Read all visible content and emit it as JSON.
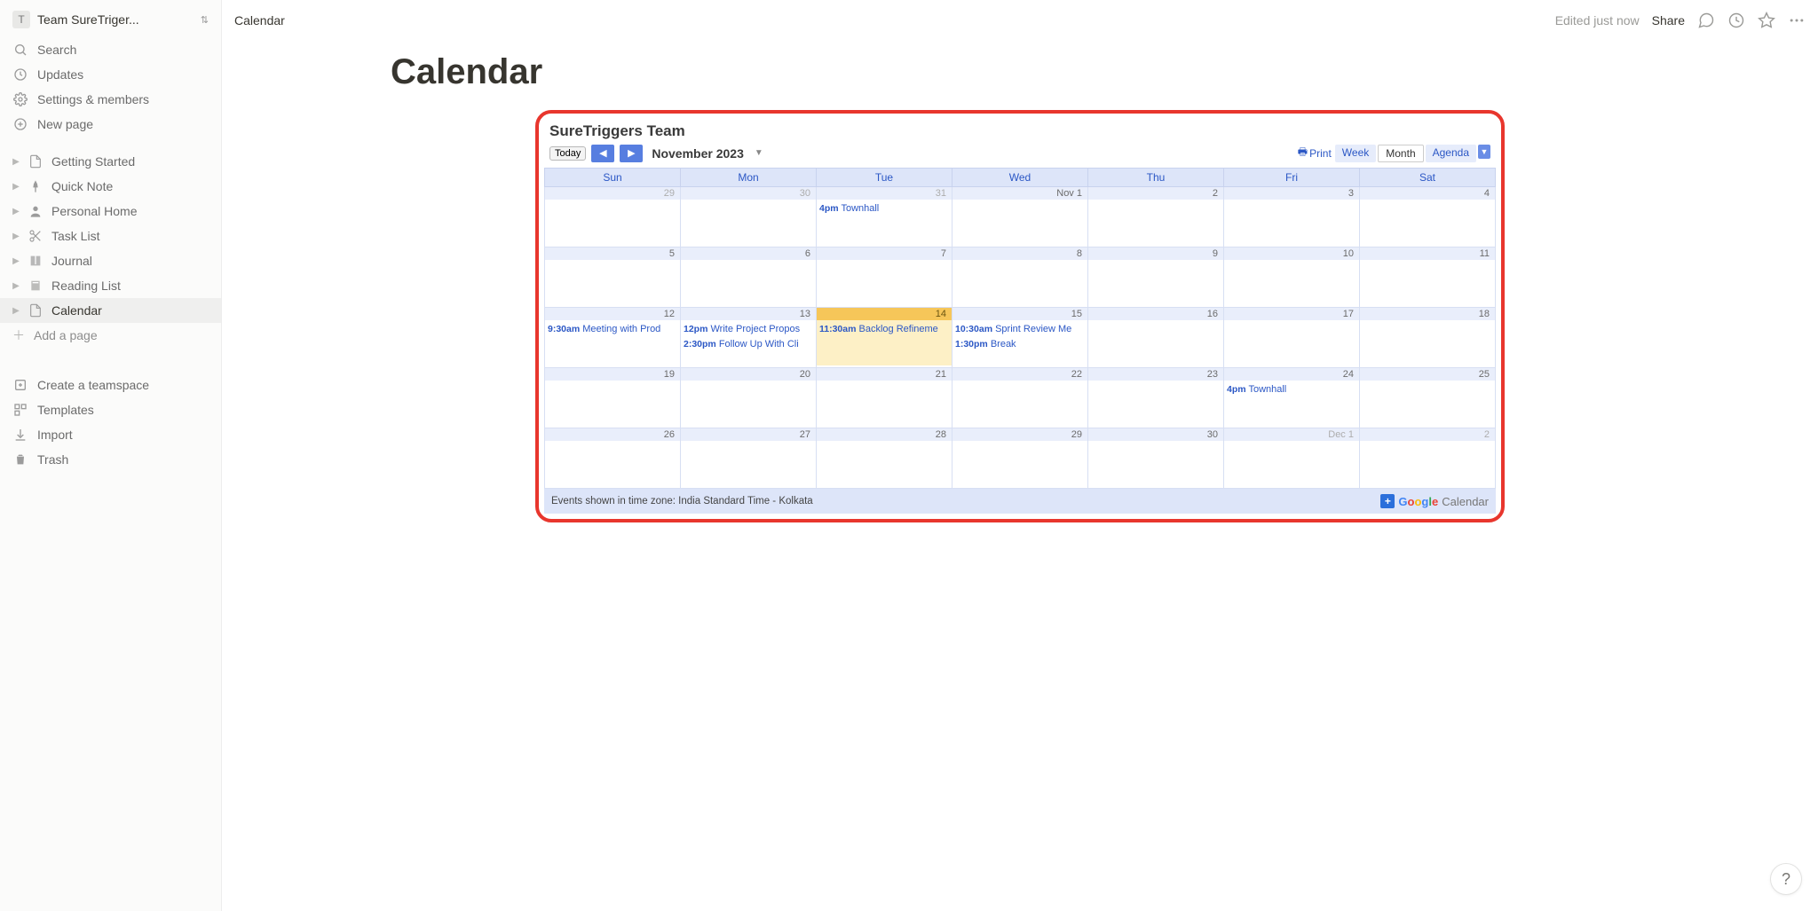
{
  "workspace": {
    "badge": "T",
    "name": "Team SureTriger..."
  },
  "sidebar": {
    "search": "Search",
    "updates": "Updates",
    "settings": "Settings & members",
    "newpage": "New page",
    "pages": [
      {
        "label": "Getting Started",
        "icon": "doc"
      },
      {
        "label": "Quick Note",
        "icon": "pin"
      },
      {
        "label": "Personal Home",
        "icon": "person"
      },
      {
        "label": "Task List",
        "icon": "scissors"
      },
      {
        "label": "Journal",
        "icon": "book"
      },
      {
        "label": "Reading List",
        "icon": "book-gray"
      },
      {
        "label": "Calendar",
        "icon": "doc"
      }
    ],
    "addpage": "Add a page",
    "create_ts": "Create a teamspace",
    "templates": "Templates",
    "import": "Import",
    "trash": "Trash"
  },
  "topbar": {
    "breadcrumb": "Calendar",
    "edited": "Edited just now",
    "share": "Share"
  },
  "page": {
    "title": "Calendar"
  },
  "calendar": {
    "title": "SureTriggers Team",
    "today": "Today",
    "month_label": "November 2023",
    "print": "Print",
    "views": {
      "week": "Week",
      "month": "Month",
      "agenda": "Agenda"
    },
    "days": [
      "Sun",
      "Mon",
      "Tue",
      "Wed",
      "Thu",
      "Fri",
      "Sat"
    ],
    "footer": "Events shown in time zone: India Standard Time - Kolkata",
    "gcal": "Calendar",
    "weeks": [
      [
        {
          "n": "29",
          "other": true
        },
        {
          "n": "30",
          "other": true
        },
        {
          "n": "31",
          "other": true,
          "events": [
            {
              "t": "4pm",
              "title": "Townhall"
            }
          ]
        },
        {
          "n": "Nov 1"
        },
        {
          "n": "2"
        },
        {
          "n": "3"
        },
        {
          "n": "4"
        }
      ],
      [
        {
          "n": "5"
        },
        {
          "n": "6"
        },
        {
          "n": "7"
        },
        {
          "n": "8"
        },
        {
          "n": "9"
        },
        {
          "n": "10"
        },
        {
          "n": "11"
        }
      ],
      [
        {
          "n": "12",
          "events": [
            {
              "t": "9:30am",
              "title": "Meeting with Prod"
            }
          ]
        },
        {
          "n": "13",
          "events": [
            {
              "t": "12pm",
              "title": "Write Project Propos"
            },
            {
              "t": "2:30pm",
              "title": "Follow Up With Cli"
            }
          ]
        },
        {
          "n": "14",
          "today": true,
          "events": [
            {
              "t": "11:30am",
              "title": "Backlog Refineme"
            }
          ]
        },
        {
          "n": "15",
          "events": [
            {
              "t": "10:30am",
              "title": "Sprint Review Me"
            },
            {
              "t": "1:30pm",
              "title": "Break"
            }
          ]
        },
        {
          "n": "16"
        },
        {
          "n": "17"
        },
        {
          "n": "18"
        }
      ],
      [
        {
          "n": "19"
        },
        {
          "n": "20"
        },
        {
          "n": "21"
        },
        {
          "n": "22"
        },
        {
          "n": "23"
        },
        {
          "n": "24",
          "events": [
            {
              "t": "4pm",
              "title": "Townhall"
            }
          ]
        },
        {
          "n": "25"
        }
      ],
      [
        {
          "n": "26"
        },
        {
          "n": "27"
        },
        {
          "n": "28"
        },
        {
          "n": "29"
        },
        {
          "n": "30"
        },
        {
          "n": "Dec 1",
          "other": true
        },
        {
          "n": "2",
          "other": true
        }
      ]
    ]
  },
  "help": "?"
}
